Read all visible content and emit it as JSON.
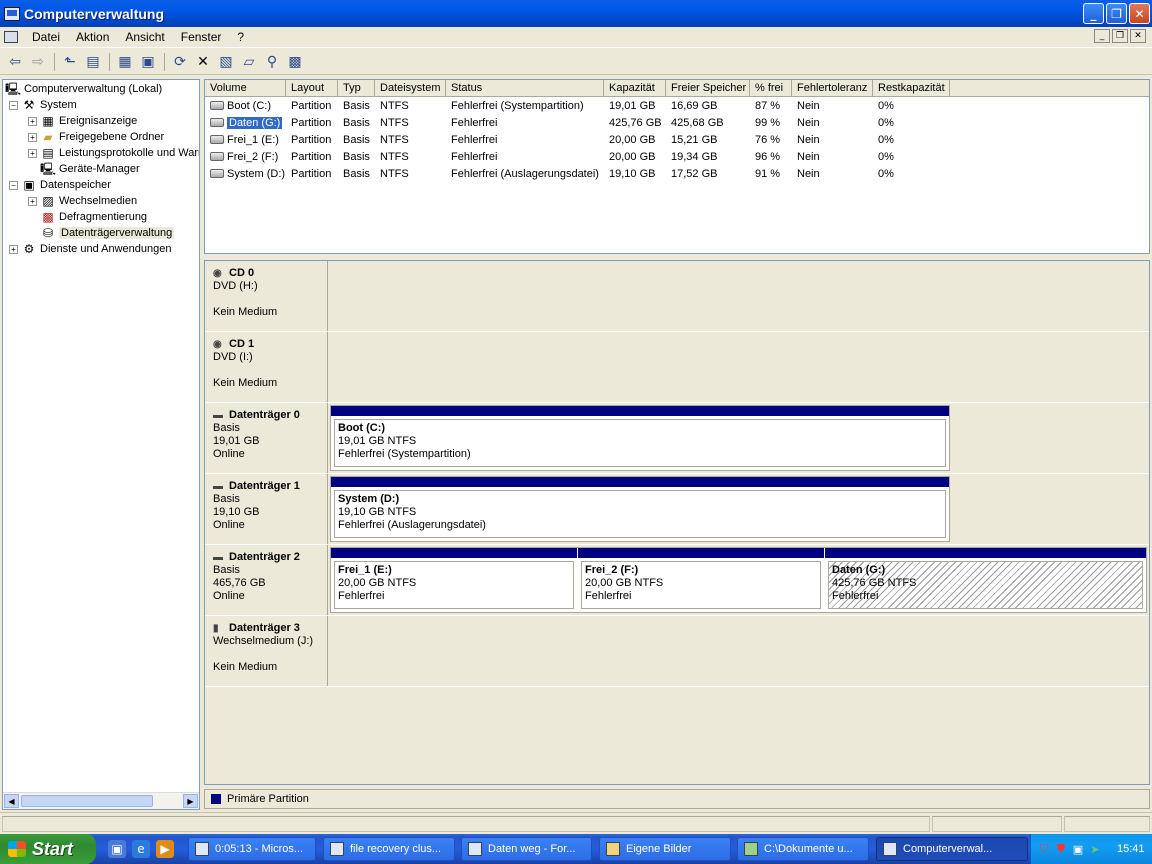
{
  "window": {
    "title": "Computerverwaltung"
  },
  "menu": {
    "items": [
      "Datei",
      "Aktion",
      "Ansicht",
      "Fenster",
      "?"
    ]
  },
  "tree": {
    "items": [
      {
        "label": "Computerverwaltung (Lokal)",
        "icon": "computer-icon"
      },
      {
        "label": "System",
        "icon": "tools-icon"
      },
      {
        "label": "Ereignisanzeige",
        "icon": "event-viewer-icon"
      },
      {
        "label": "Freigegebene Ordner",
        "icon": "shared-folder-icon"
      },
      {
        "label": "Leistungsprotokolle und Warnungen",
        "icon": "performance-icon"
      },
      {
        "label": "Geräte-Manager",
        "icon": "device-manager-icon"
      },
      {
        "label": "Datenspeicher",
        "icon": "storage-icon"
      },
      {
        "label": "Wechselmedien",
        "icon": "removable-media-icon"
      },
      {
        "label": "Defragmentierung",
        "icon": "defrag-icon"
      },
      {
        "label": "Datenträgerverwaltung",
        "icon": "disk-management-icon"
      },
      {
        "label": "Dienste und Anwendungen",
        "icon": "services-icon"
      }
    ]
  },
  "volumes": {
    "columns": [
      "Volume",
      "Layout",
      "Typ",
      "Dateisystem",
      "Status",
      "Kapazität",
      "Freier Speicher",
      "% frei",
      "Fehlertoleranz",
      "Restkapazität"
    ],
    "rows": [
      [
        "Boot (C:)",
        "Partition",
        "Basis",
        "NTFS",
        "Fehlerfrei (Systempartition)",
        "19,01 GB",
        "16,69 GB",
        "87 %",
        "Nein",
        "0%"
      ],
      [
        "Daten (G:)",
        "Partition",
        "Basis",
        "NTFS",
        "Fehlerfrei",
        "425,76 GB",
        "425,68 GB",
        "99 %",
        "Nein",
        "0%"
      ],
      [
        "Frei_1 (E:)",
        "Partition",
        "Basis",
        "NTFS",
        "Fehlerfrei",
        "20,00 GB",
        "15,21 GB",
        "76 %",
        "Nein",
        "0%"
      ],
      [
        "Frei_2 (F:)",
        "Partition",
        "Basis",
        "NTFS",
        "Fehlerfrei",
        "20,00 GB",
        "19,34 GB",
        "96 %",
        "Nein",
        "0%"
      ],
      [
        "System (D:)",
        "Partition",
        "Basis",
        "NTFS",
        "Fehlerfrei (Auslagerungsdatei)",
        "19,10 GB",
        "17,52 GB",
        "91 %",
        "Nein",
        "0%"
      ]
    ],
    "selected_row": 1
  },
  "disks": [
    {
      "name": "CD 0",
      "l1": "DVD (H:)",
      "l2": "",
      "l3": "Kein Medium",
      "icon": "cd-drive-icon",
      "partitions": []
    },
    {
      "name": "CD 1",
      "l1": "DVD (I:)",
      "l2": "",
      "l3": "Kein Medium",
      "icon": "cd-drive-icon",
      "partitions": []
    },
    {
      "name": "Datenträger 0",
      "l1": "Basis",
      "l2": "19,01 GB",
      "l3": "Online",
      "icon": "hard-disk-icon",
      "partitions": [
        {
          "title": "Boot  (C:)",
          "size": "19,01 GB NTFS",
          "status": "Fehlerfrei (Systempartition)",
          "selected": false
        }
      ]
    },
    {
      "name": "Datenträger 1",
      "l1": "Basis",
      "l2": "19,10 GB",
      "l3": "Online",
      "icon": "hard-disk-icon",
      "partitions": [
        {
          "title": "System  (D:)",
          "size": "19,10 GB NTFS",
          "status": "Fehlerfrei (Auslagerungsdatei)",
          "selected": false
        }
      ]
    },
    {
      "name": "Datenträger 2",
      "l1": "Basis",
      "l2": "465,76 GB",
      "l3": "Online",
      "icon": "hard-disk-icon",
      "partitions": [
        {
          "title": "Frei_1  (E:)",
          "size": "20,00 GB NTFS",
          "status": "Fehlerfrei",
          "selected": false
        },
        {
          "title": "Frei_2  (F:)",
          "size": "20,00 GB NTFS",
          "status": "Fehlerfrei",
          "selected": false
        },
        {
          "title": "Daten  (G:)",
          "size": "425,76 GB NTFS",
          "status": "Fehlerfrei",
          "selected": true
        }
      ]
    },
    {
      "name": "Datenträger 3",
      "l1": "Wechselmedium (J:)",
      "l2": "",
      "l3": "Kein Medium",
      "icon": "removable-disk-icon",
      "partitions": []
    }
  ],
  "legend": {
    "label": "Primäre Partition",
    "color": "#000080"
  },
  "taskbar": {
    "start": "Start",
    "tasks": [
      "0:05:13 - Micros...",
      "file recovery clus...",
      "Daten weg - For...",
      "Eigene Bilder",
      "C:\\Dokumente u...",
      "Computerverwal..."
    ],
    "active_task": 5,
    "clock": "15:41"
  },
  "colors": {
    "selection": "#316ac5",
    "partition_bar": "#000080",
    "title_bar": "#0058e6"
  }
}
